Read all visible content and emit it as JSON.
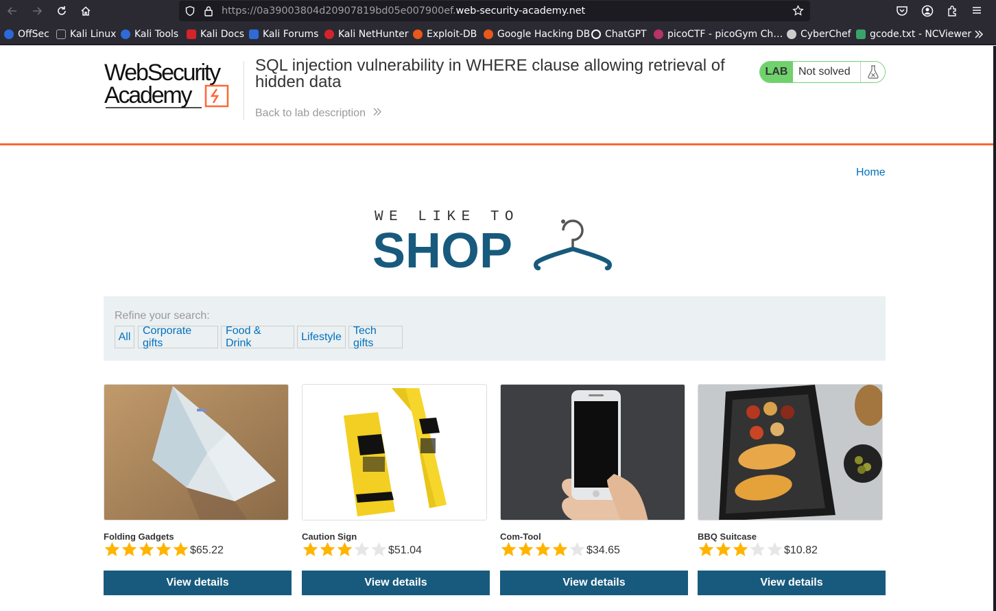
{
  "browser": {
    "url_prefix": "https://0a39003804d20907819bd05e007900ef.",
    "url_domain": "web-security-academy.net",
    "bookmarks": [
      {
        "label": "OffSec",
        "color": "#2a6ad8"
      },
      {
        "label": "Kali Linux",
        "color": "#3b3b3b"
      },
      {
        "label": "Kali Tools",
        "color": "#2f6bd6"
      },
      {
        "label": "Kali Docs",
        "color": "#d4232b"
      },
      {
        "label": "Kali Forums",
        "color": "#2f6bd6"
      },
      {
        "label": "Kali NetHunter",
        "color": "#d4232b"
      },
      {
        "label": "Exploit-DB",
        "color": "#e8581a"
      },
      {
        "label": "Google Hacking DB",
        "color": "#e8581a"
      },
      {
        "label": "ChatGPT",
        "color": "#ffffff"
      },
      {
        "label": "picoCTF - picoGym Ch…",
        "color": "#b8336a"
      },
      {
        "label": "CyberChef",
        "color": "#cccccc"
      },
      {
        "label": "gcode.txt - NCViewer",
        "color": "#3aa36a"
      }
    ]
  },
  "header": {
    "logo_line1": "WebSecurity",
    "logo_line2": "Academy",
    "lab_title": "SQL injection vulnerability in WHERE clause allowing retrieval of hidden data",
    "back_link": "Back to lab description",
    "lab_tag": "LAB",
    "lab_status": "Not solved"
  },
  "nav": {
    "home": "Home"
  },
  "shop_logo": {
    "tagline": "WE LIKE TO",
    "word": "SHOP"
  },
  "filters": {
    "label": "Refine your search:",
    "categories": [
      "All",
      "Corporate gifts",
      "Food & Drink",
      "Lifestyle",
      "Tech gifts"
    ]
  },
  "products": [
    {
      "name": "Folding Gadgets",
      "rating": 5,
      "price": "$65.22"
    },
    {
      "name": "Caution Sign",
      "rating": 3,
      "price": "$51.04"
    },
    {
      "name": "Com-Tool",
      "rating": 4,
      "price": "$34.65"
    },
    {
      "name": "BBQ Suitcase",
      "rating": 3,
      "price": "$10.82"
    }
  ],
  "view_details_label": "View details",
  "colors": {
    "accent": "#ff6633",
    "link": "#0071bc",
    "button": "#185a7d",
    "lab_green": "#70d16d",
    "star": "#ffb400"
  }
}
